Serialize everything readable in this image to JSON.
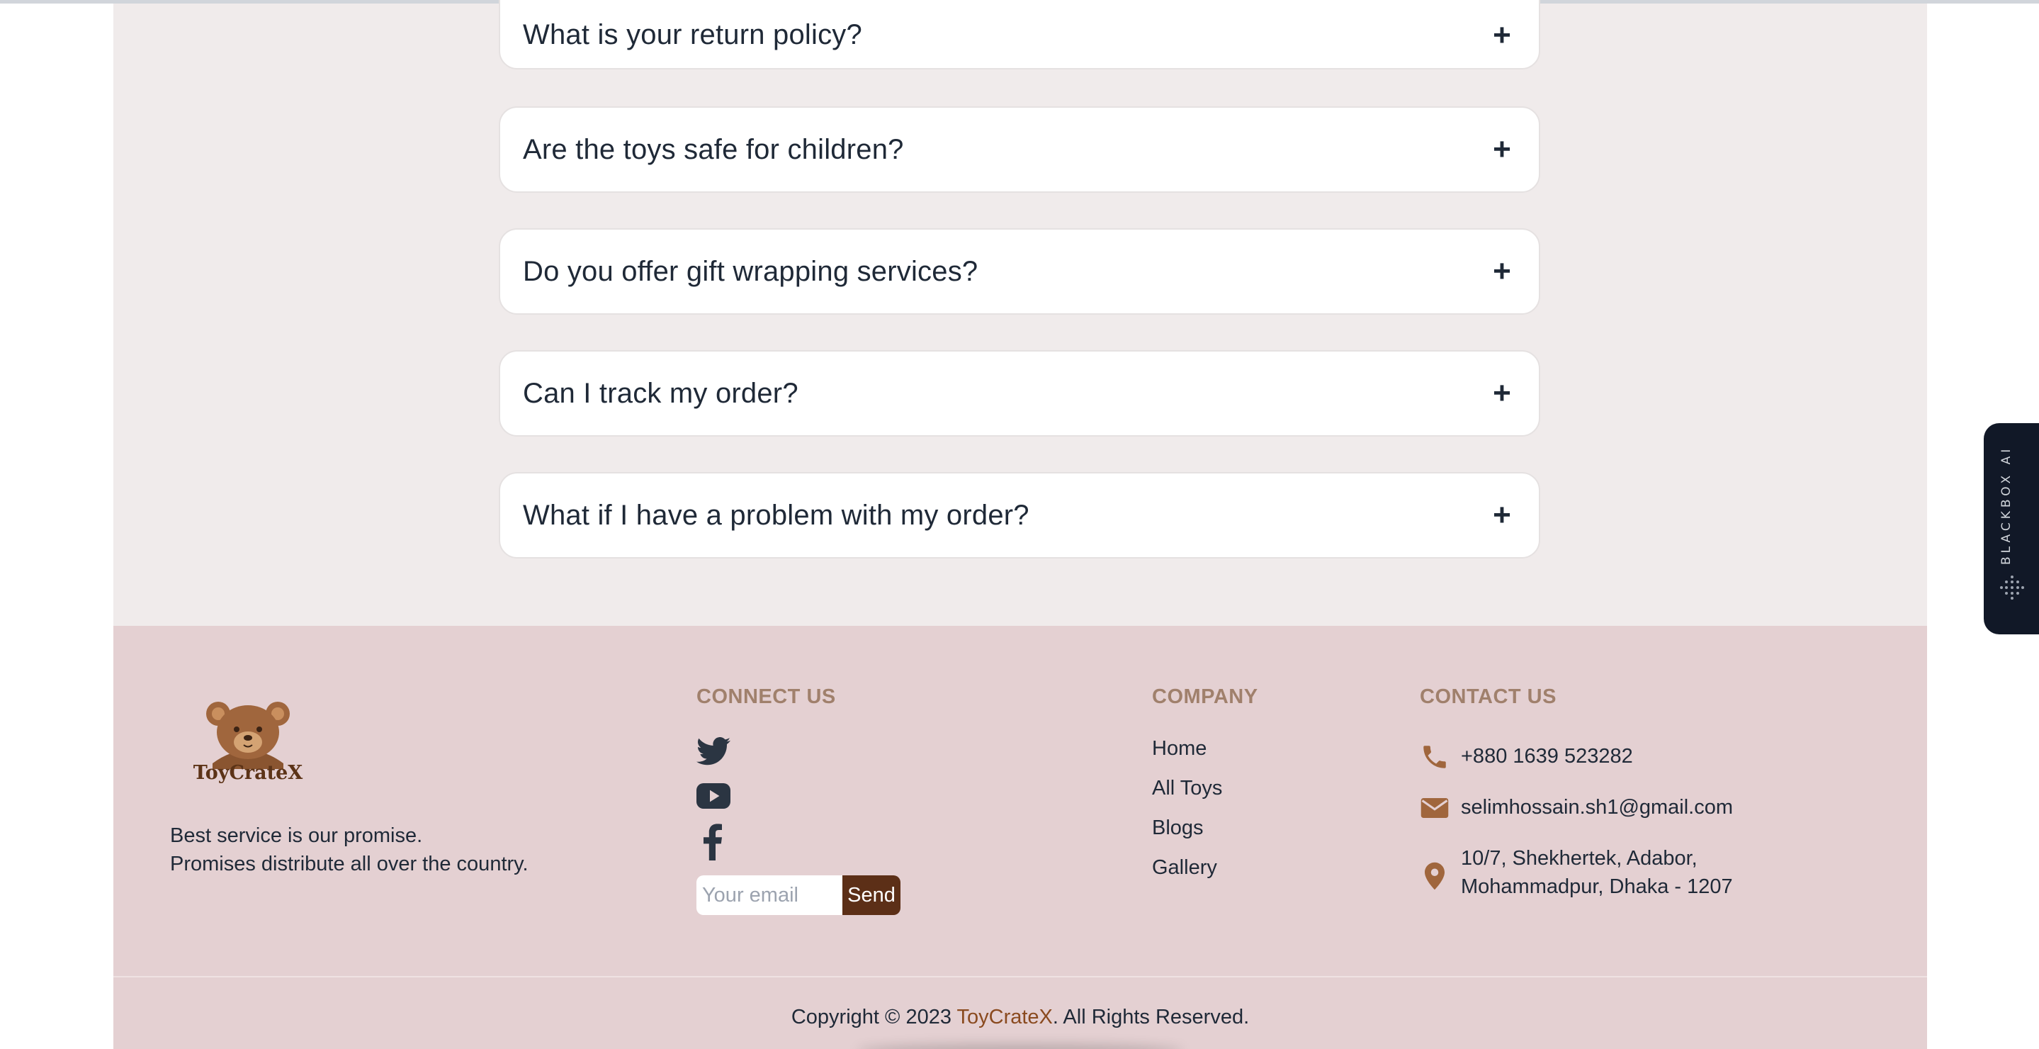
{
  "faq": {
    "items": [
      {
        "question": "What is your return policy?",
        "toggle": "+"
      },
      {
        "question": "Are the toys safe for children?",
        "toggle": "+"
      },
      {
        "question": "Do you offer gift wrapping services?",
        "toggle": "+"
      },
      {
        "question": "Can I track my order?",
        "toggle": "+"
      },
      {
        "question": "What if I have a problem with my order?",
        "toggle": "+"
      }
    ]
  },
  "footer": {
    "brand": {
      "logo_text": "ToyCrateX",
      "tagline_line1": "Best service is our promise.",
      "tagline_line2": "Promises distribute all over the country."
    },
    "connect": {
      "title": "CONNECT US",
      "icons": [
        "twitter-icon",
        "youtube-icon",
        "facebook-icon"
      ],
      "email_placeholder": "Your email",
      "send_label": "Send"
    },
    "company": {
      "title": "COMPANY",
      "links": [
        "Home",
        "All Toys",
        "Blogs",
        "Gallery"
      ]
    },
    "contact": {
      "title": "CONTACT US",
      "phone": "+880 1639 523282",
      "email": "selimhossain.sh1@gmail.com",
      "address_line1": "10/7, Shekhertek, Adabor,",
      "address_line2": "Mohammadpur, Dhaka - 1207"
    },
    "copyright": {
      "prefix": "Copyright © 2023 ",
      "brand": "ToyCrateX",
      "suffix": ". All Rights Reserved."
    }
  },
  "widget": {
    "label": "BLACKBOX AI"
  },
  "colors": {
    "faq_bg": "#f0ebeb",
    "footer_bg": "#e4d0d2",
    "heading_brown": "#a0806c",
    "icon_brown": "#a0663d",
    "button_brown": "#5c2f17",
    "brand_link": "#8a4a1f"
  }
}
